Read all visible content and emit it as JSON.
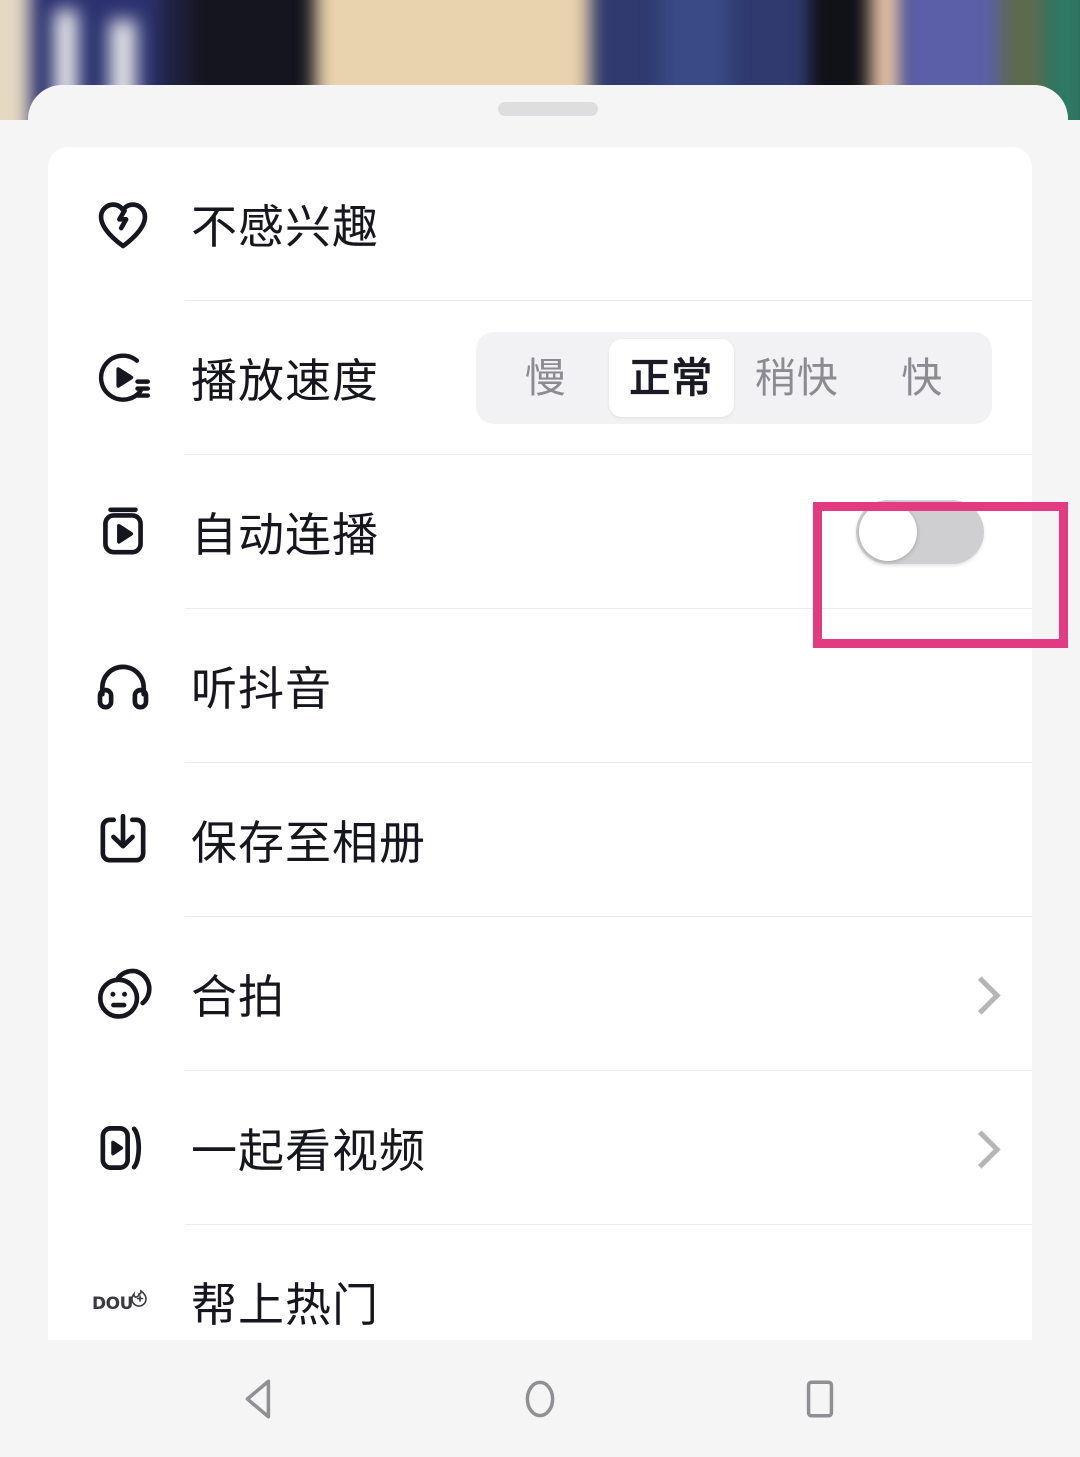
{
  "app": {
    "name": "douyin-video-options-sheet",
    "background": "blurred video of a group of people standing"
  },
  "sheet": {
    "handle_name": "drag-handle"
  },
  "menu": {
    "rows": [
      {
        "id": "not-interested",
        "icon": "broken-heart-icon",
        "label": "不感兴趣",
        "control": "none"
      },
      {
        "id": "play-speed",
        "icon": "play-speed-icon",
        "label": "播放速度",
        "control": "segmented"
      },
      {
        "id": "auto-play",
        "icon": "auto-play-icon",
        "label": "自动连播",
        "control": "toggle"
      },
      {
        "id": "listen-douyin",
        "icon": "headphones-icon",
        "label": "听抖音",
        "control": "none"
      },
      {
        "id": "save-to-album",
        "icon": "download-icon",
        "label": "保存至相册",
        "control": "none"
      },
      {
        "id": "duet",
        "icon": "duet-face-icon",
        "label": "合拍",
        "control": "chevron"
      },
      {
        "id": "watch-together",
        "icon": "watch-together-icon",
        "label": "一起看视频",
        "control": "chevron"
      },
      {
        "id": "promote",
        "icon": "dou-plus-icon",
        "label": "帮上热门",
        "control": "none"
      }
    ]
  },
  "speed_control": {
    "options": [
      "慢",
      "正常",
      "稍快",
      "快"
    ],
    "selected": "正常",
    "selected_index": 1
  },
  "auto_play_toggle": {
    "state": "off",
    "state_label": "关闭"
  },
  "annotation": {
    "shape": "rectangle",
    "color": "#e33b81",
    "target": "auto-play-toggle"
  },
  "nav_bar": {
    "buttons": [
      {
        "id": "back",
        "icon": "back-triangle-icon"
      },
      {
        "id": "home",
        "icon": "home-circle-icon"
      },
      {
        "id": "recents",
        "icon": "recents-square-icon"
      }
    ],
    "color": "#8f8f94"
  },
  "colors": {
    "sheet_bg": "#f5f5f6",
    "card_bg": "#ffffff",
    "text": "#16161e",
    "muted_text": "#8b8b91",
    "divider": "#ededef",
    "segment_track": "#f2f2f4",
    "toggle_off": "#cfcfd2",
    "accent_annotation": "#e33b81"
  }
}
